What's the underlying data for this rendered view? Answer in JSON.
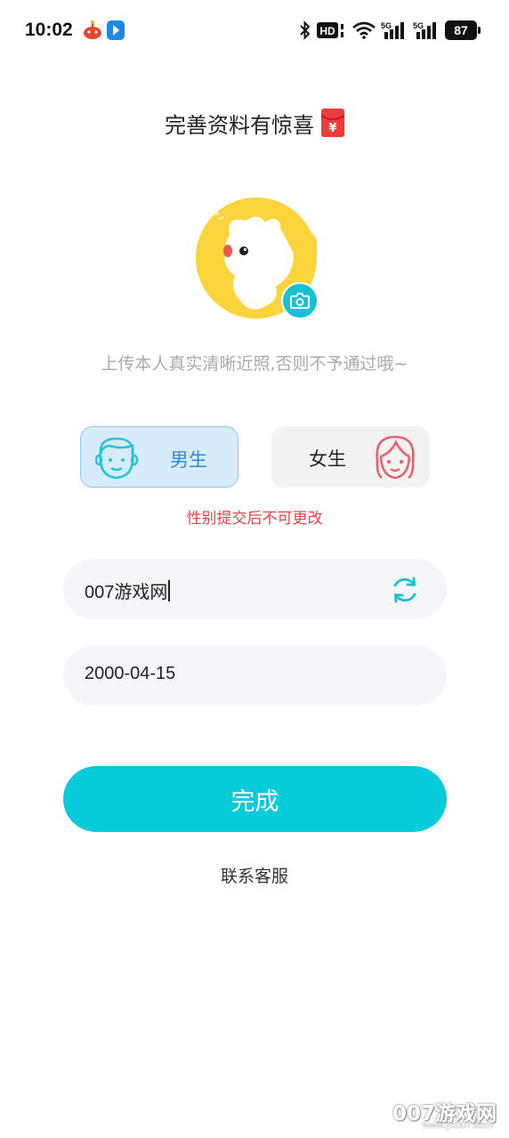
{
  "status_bar": {
    "time": "10:02",
    "battery": "87",
    "icons": [
      "notification-app-icon",
      "notification-app-icon",
      "bluetooth-icon",
      "hd-icon",
      "wifi-icon",
      "signal-5g-icon",
      "signal-5g-icon"
    ],
    "hd_label": "HD",
    "network_label": "5G"
  },
  "header": {
    "title": "完善资料有惊喜",
    "envelope_symbol": "¥"
  },
  "avatar": {
    "hint": "上传本人真实清晰近照,否则不予通过哦~",
    "camera_icon": "camera-icon"
  },
  "gender": {
    "male_label": "男生",
    "female_label": "女生",
    "selected": "male",
    "warning": "性别提交后不可更改"
  },
  "form": {
    "nickname": "007游戏网",
    "birthday": "2000-04-15"
  },
  "actions": {
    "submit_label": "完成",
    "contact_label": "联系客服"
  },
  "watermark": {
    "main": "007游戏网",
    "sub": "www.yx007.com"
  },
  "colors": {
    "accent": "#08cbd9",
    "male_bg": "#d6ebfb",
    "male_text": "#2c8bd6",
    "female_icon": "#e8606e",
    "warning": "#ec4444",
    "avatar_yellow": "#fbd33a"
  }
}
